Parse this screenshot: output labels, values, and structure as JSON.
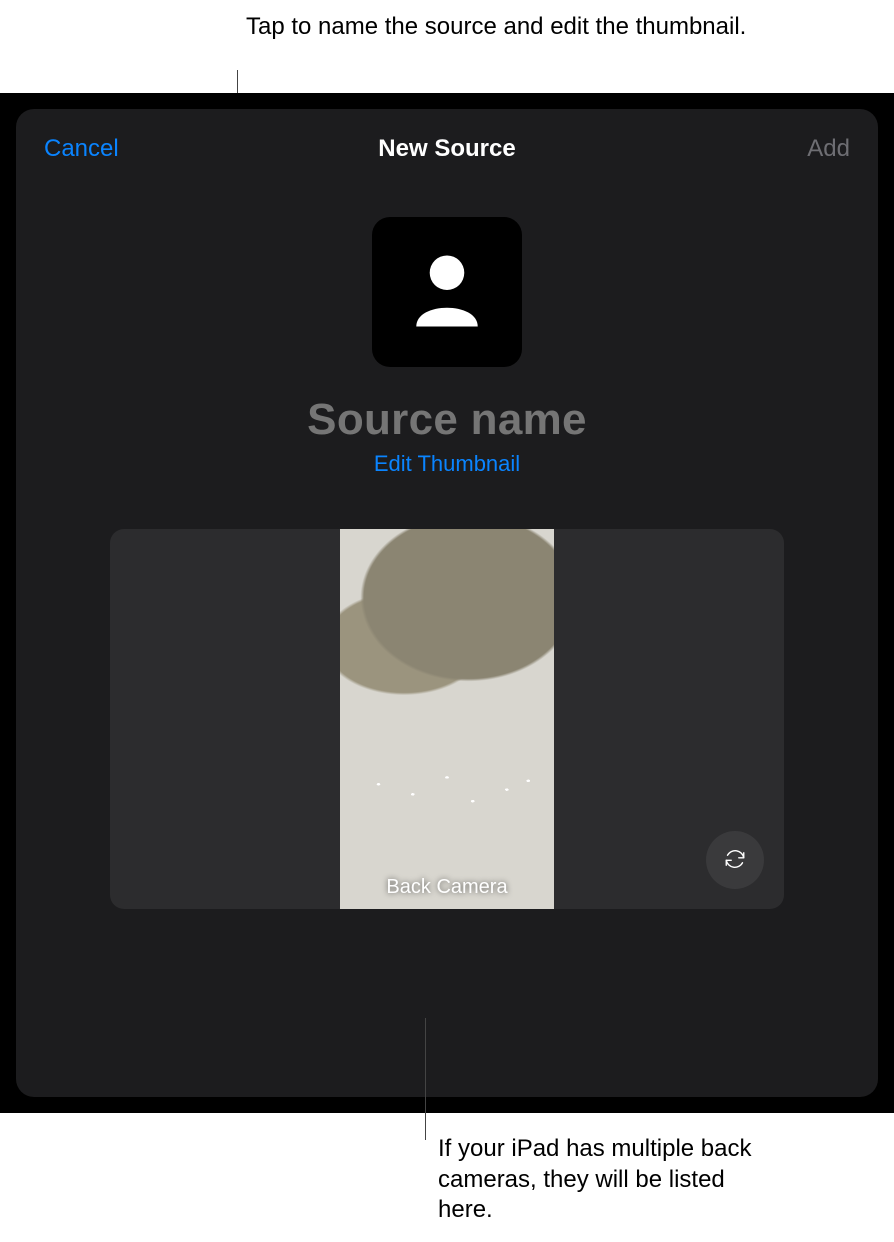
{
  "callouts": {
    "top": "Tap to name the source and edit the thumbnail.",
    "bottom": "If your iPad has multiple back cameras, they will be listed here."
  },
  "navbar": {
    "cancel": "Cancel",
    "title": "New Source",
    "add": "Add"
  },
  "source": {
    "placeholder": "Source name",
    "edit_thumbnail": "Edit Thumbnail"
  },
  "preview": {
    "label": "Back Camera"
  },
  "icons": {
    "thumbnail": "person-placeholder-icon",
    "flip": "camera-flip-icon"
  }
}
